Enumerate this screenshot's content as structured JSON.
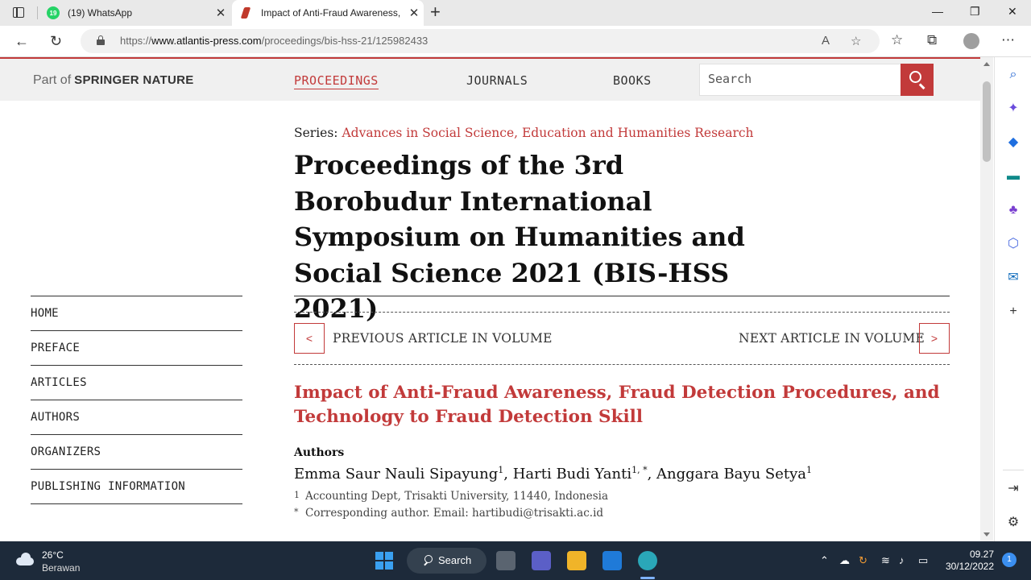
{
  "browser": {
    "tabs": [
      {
        "label": "(19) WhatsApp",
        "badge": "19",
        "active": false
      },
      {
        "label": "Impact of Anti-Fraud Awareness,",
        "active": true
      }
    ],
    "new_tab_label": "+",
    "url_prefix": "https://",
    "url_host": "www.atlantis-press.com",
    "url_path": "/proceedings/bis-hss-21/125982433",
    "window_controls": {
      "minimize": "—",
      "restore": "❐",
      "close": "✕"
    }
  },
  "site": {
    "part_of": "Part of",
    "brand": "SPRINGER NATURE",
    "menu": [
      "PROCEEDINGS",
      "JOURNALS",
      "BOOKS"
    ],
    "search_placeholder": "Search",
    "accent": "#c23a3a"
  },
  "content": {
    "series_label": "Series:",
    "series_name": "Advances in Social Science, Education and Humanities Research",
    "proceedings_title": "Proceedings of the 3rd Borobudur International Symposium on Humanities and Social Science 2021 (BIS-HSS 2021)",
    "left_nav": [
      "HOME",
      "PREFACE",
      "ARTICLES",
      "AUTHORS",
      "ORGANIZERS",
      "PUBLISHING INFORMATION"
    ],
    "prev_label": "PREVIOUS ARTICLE IN VOLUME",
    "next_label": "NEXT ARTICLE IN VOLUME",
    "prev_arrow": "<",
    "next_arrow": ">",
    "article_title": "Impact of Anti-Fraud Awareness, Fraud Detection Procedures, and Technology to Fraud Detection Skill",
    "authors_heading": "Authors",
    "authors": [
      {
        "name": "Emma Saur Nauli Sipayung",
        "sup": "1",
        "sep": ", "
      },
      {
        "name": "Harti Budi Yanti",
        "sup": "1, *",
        "sep": ", "
      },
      {
        "name": "Anggara Bayu Setya",
        "sup": "1",
        "sep": ""
      }
    ],
    "affiliations": [
      {
        "mark": "1",
        "text": "Accounting Dept, Trisakti University, 11440, Indonesia"
      },
      {
        "mark": "*",
        "text": "Corresponding author. Email: hartibudi@trisakti.ac.id"
      }
    ]
  },
  "taskbar": {
    "temperature": "26°C",
    "condition": "Berawan",
    "search_label": "Search",
    "time": "09.27",
    "date": "30/12/2022",
    "notification_count": "1"
  }
}
